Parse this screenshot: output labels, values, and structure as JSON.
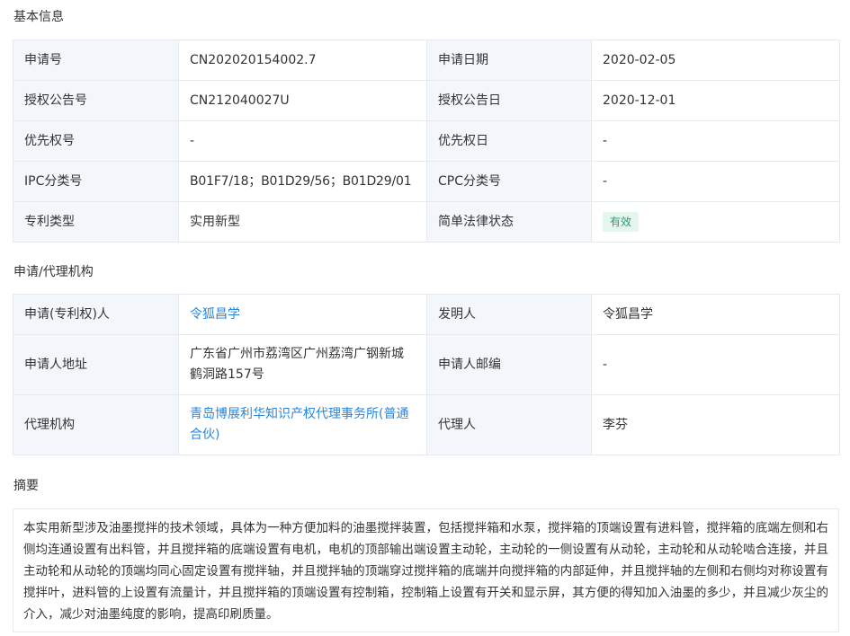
{
  "basic_info": {
    "title": "基本信息",
    "rows": [
      {
        "l1": "申请号",
        "v1": "CN202020154002.7",
        "l2": "申请日期",
        "v2": "2020-02-05"
      },
      {
        "l1": "授权公告号",
        "v1": "CN212040027U",
        "l2": "授权公告日",
        "v2": "2020-12-01"
      },
      {
        "l1": "优先权号",
        "v1": "-",
        "l2": "优先权日",
        "v2": "-"
      },
      {
        "l1": "IPC分类号",
        "v1": "B01F7/18；B01D29/56；B01D29/01",
        "l2": "CPC分类号",
        "v2": "-"
      },
      {
        "l1": "专利类型",
        "v1": "实用新型",
        "l2": "简单法律状态",
        "v2": "有效"
      }
    ]
  },
  "agency_info": {
    "title": "申请/代理机构",
    "rows": [
      {
        "l1": "申请(专利权)人",
        "v1": "令狐昌学",
        "l2": "发明人",
        "v2": "令狐昌学"
      },
      {
        "l1": "申请人地址",
        "v1": "广东省广州市荔湾区广州荔湾广钢新城鹤洞路157号",
        "l2": "申请人邮编",
        "v2": "-"
      },
      {
        "l1": "代理机构",
        "v1": "青岛博展利华知识产权代理事务所(普通合伙)",
        "l2": "代理人",
        "v2": "李芬"
      }
    ]
  },
  "abstract": {
    "title": "摘要",
    "text": "本实用新型涉及油墨搅拌的技术领域，具体为一种方便加料的油墨搅拌装置，包括搅拌箱和水泵，搅拌箱的顶端设置有进料管，搅拌箱的底端左侧和右侧均连通设置有出料管，并且搅拌箱的底端设置有电机，电机的顶部输出端设置主动轮，主动轮的一侧设置有从动轮，主动轮和从动轮啮合连接，并且主动轮和从动轮的顶端均同心固定设置有搅拌轴，并且搅拌轴的顶端穿过搅拌箱的底端并向搅拌箱的内部延伸，并且搅拌轴的左侧和右侧均对称设置有搅拌叶，进料管的上设置有流量计，并且搅拌箱的顶端设置有控制箱，控制箱上设置有开关和显示屏，其方便的得知加入油墨的多少，并且减少灰尘的介入，减少对油墨纯度的影响，提高印刷质量。"
  },
  "colors": {
    "label_bg": "#f3f7fb",
    "border": "#e6e9ee",
    "link": "#2a86d8",
    "status_bg": "#e4f6ee",
    "status_text": "#29a06a"
  }
}
